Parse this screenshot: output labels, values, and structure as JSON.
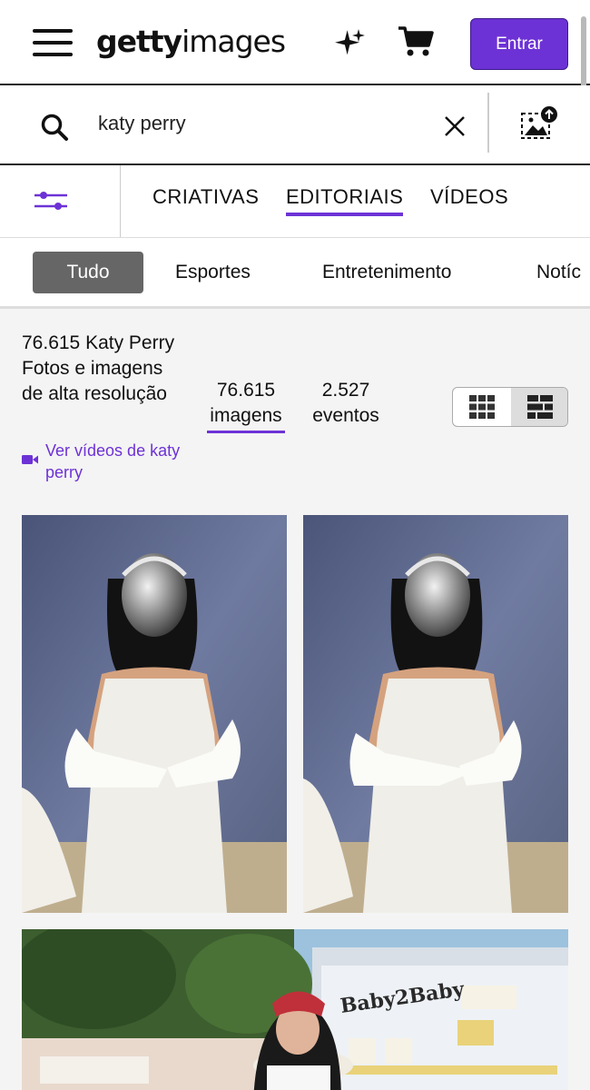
{
  "header": {
    "logo_bold": "getty",
    "logo_light": "images",
    "login_label": "Entrar",
    "icons": [
      "menu-icon",
      "sparkles-icon",
      "cart-icon"
    ]
  },
  "search": {
    "query": "katy perry",
    "icons": [
      "search-icon",
      "close-icon",
      "visual-search-icon"
    ]
  },
  "tabs": [
    {
      "label": "CRIATIVAS",
      "active": false
    },
    {
      "label": "EDITORIAIS",
      "active": true
    },
    {
      "label": "VÍDEOS",
      "active": false
    }
  ],
  "categories": [
    {
      "label": "Tudo",
      "active": true
    },
    {
      "label": "Esportes",
      "active": false
    },
    {
      "label": "Entretenimento",
      "active": false
    },
    {
      "label": "Notíc",
      "active": false
    }
  ],
  "results": {
    "title": "76.615 Katy Perry Fotos e imagens de alta resolução",
    "video_link": "Ver vídeos de katy perry",
    "images_count": "76.615",
    "images_label": "imagens",
    "events_count": "2.527",
    "events_label": "eventos",
    "view_modes": [
      "grid-view-icon",
      "mosaic-view-icon"
    ]
  },
  "photo_banner_text": "Baby2Baby",
  "colors": {
    "accent": "#6d32d6",
    "pill_active": "#666666",
    "background": "#f4f4f4"
  }
}
